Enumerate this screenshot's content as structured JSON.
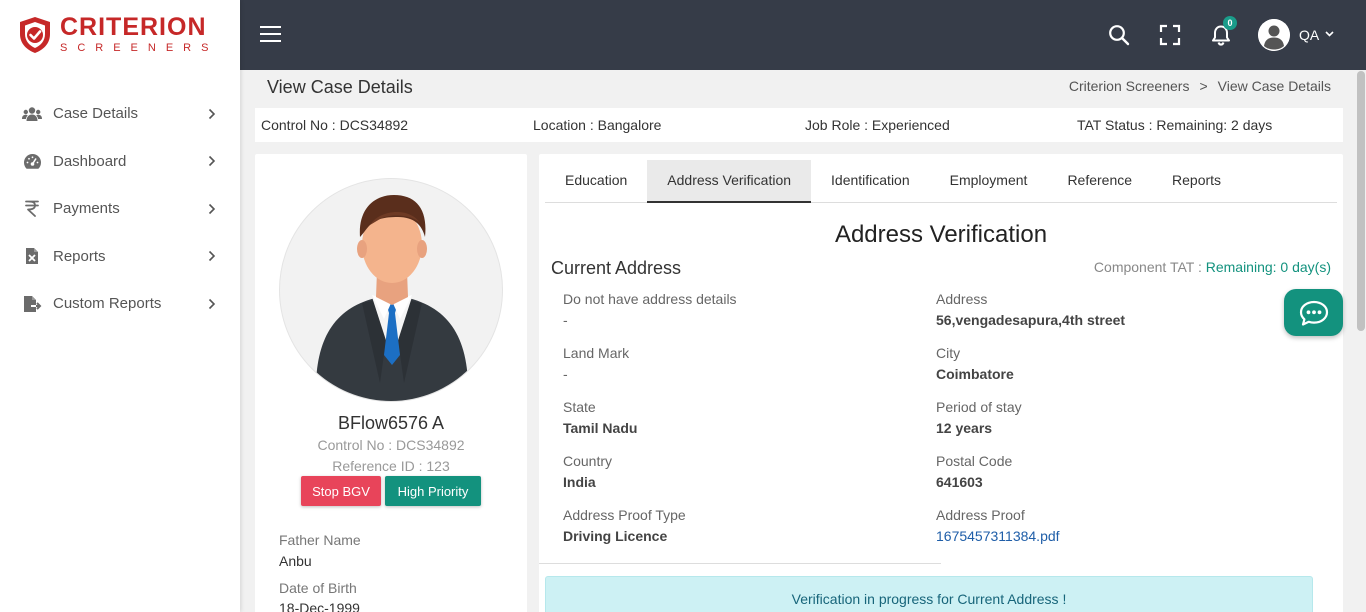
{
  "brand": {
    "name": "CRITERION",
    "tagline": "SCREENERS",
    "color": "#c62828"
  },
  "sidebar": {
    "items": [
      {
        "label": "Case Details",
        "icon": "users-icon"
      },
      {
        "label": "Dashboard",
        "icon": "tachometer-icon"
      },
      {
        "label": "Payments",
        "icon": "rupee-icon"
      },
      {
        "label": "Reports",
        "icon": "file-excel-icon"
      },
      {
        "label": "Custom Reports",
        "icon": "file-export-icon"
      }
    ]
  },
  "topbar": {
    "notification_count": "0",
    "user_name": "QA",
    "background": "#363c48"
  },
  "page": {
    "title": "View Case Details",
    "breadcrumb": {
      "home": "Criterion Screeners",
      "separator": ">",
      "current": "View Case Details"
    }
  },
  "infobar": {
    "control_no": "Control No : DCS34892",
    "location": "Location : Bangalore",
    "job_role": "Job Role : Experienced",
    "tat_status": "TAT Status : Remaining: 2 days"
  },
  "profile": {
    "name": "BFlow6576 A",
    "control_no": "Control No : DCS34892",
    "reference_id": "Reference ID : 123",
    "stop_bgv_label": "Stop BGV",
    "high_priority_label": "High Priority",
    "father_name_label": "Father Name",
    "father_name": "Anbu",
    "dob_label": "Date of Birth",
    "dob": "18-Dec-1999"
  },
  "tabs": [
    {
      "label": "Education",
      "active": false
    },
    {
      "label": "Address Verification",
      "active": true
    },
    {
      "label": "Identification",
      "active": false
    },
    {
      "label": "Employment",
      "active": false
    },
    {
      "label": "Reference",
      "active": false
    },
    {
      "label": "Reports",
      "active": false
    }
  ],
  "address": {
    "heading": "Address Verification",
    "section_title": "Current Address",
    "tat_label": "Component TAT :",
    "tat_value": "Remaining: 0 day(s)",
    "fields": {
      "no_address_label": "Do not have address details",
      "no_address_value": "-",
      "address_label": "Address",
      "address_value": "56,vengadesapura,4th street",
      "landmark_label": "Land Mark",
      "landmark_value": "-",
      "city_label": "City",
      "city_value": "Coimbatore",
      "state_label": "State",
      "state_value": "Tamil Nadu",
      "period_label": "Period of stay",
      "period_value": "12 years",
      "country_label": "Country",
      "country_value": "India",
      "postal_label": "Postal Code",
      "postal_value": "641603",
      "proof_type_label": "Address Proof Type",
      "proof_type_value": "Driving Licence",
      "proof_label": "Address Proof",
      "proof_value": "1675457311384.pdf"
    },
    "alert": "Verification in progress for Current Address !"
  },
  "colors": {
    "accent": "#13927e",
    "danger": "#e8445a",
    "link": "#1f5ea8"
  }
}
